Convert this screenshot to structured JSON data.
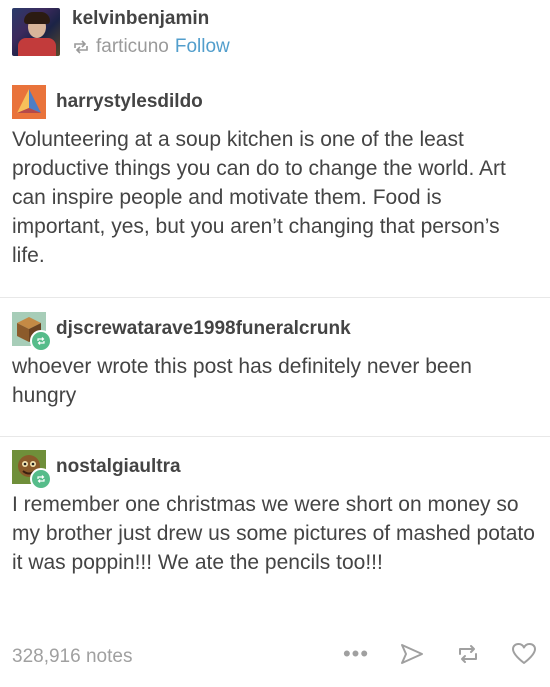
{
  "header": {
    "author": "kelvinbenjamin",
    "reblogged_from": "farticuno",
    "follow_label": "Follow"
  },
  "posts": [
    {
      "username": "harrystylesdildo",
      "text": "Volunteering at a soup kitchen is one of the least productive things you can do to change the world. Art can inspire people and motivate them. Food is important, yes, but you aren’t changing that person’s life."
    },
    {
      "username": "djscrewatarave1998funeralcrunk",
      "text": "whoever wrote this post has definitely never been hungry"
    },
    {
      "username": "nostalgiaultra",
      "text": "I remember one christmas we were short on money so my brother just drew us some pictures of mashed potato it was poppin!!! We ate the pencils too!!!"
    }
  ],
  "footer": {
    "notes": "328,916 notes",
    "more_label": "•••"
  },
  "colors": {
    "text": "#444444",
    "muted": "#9a9a9a",
    "link": "#529ecc",
    "reblog_badge": "#56bc8a"
  }
}
